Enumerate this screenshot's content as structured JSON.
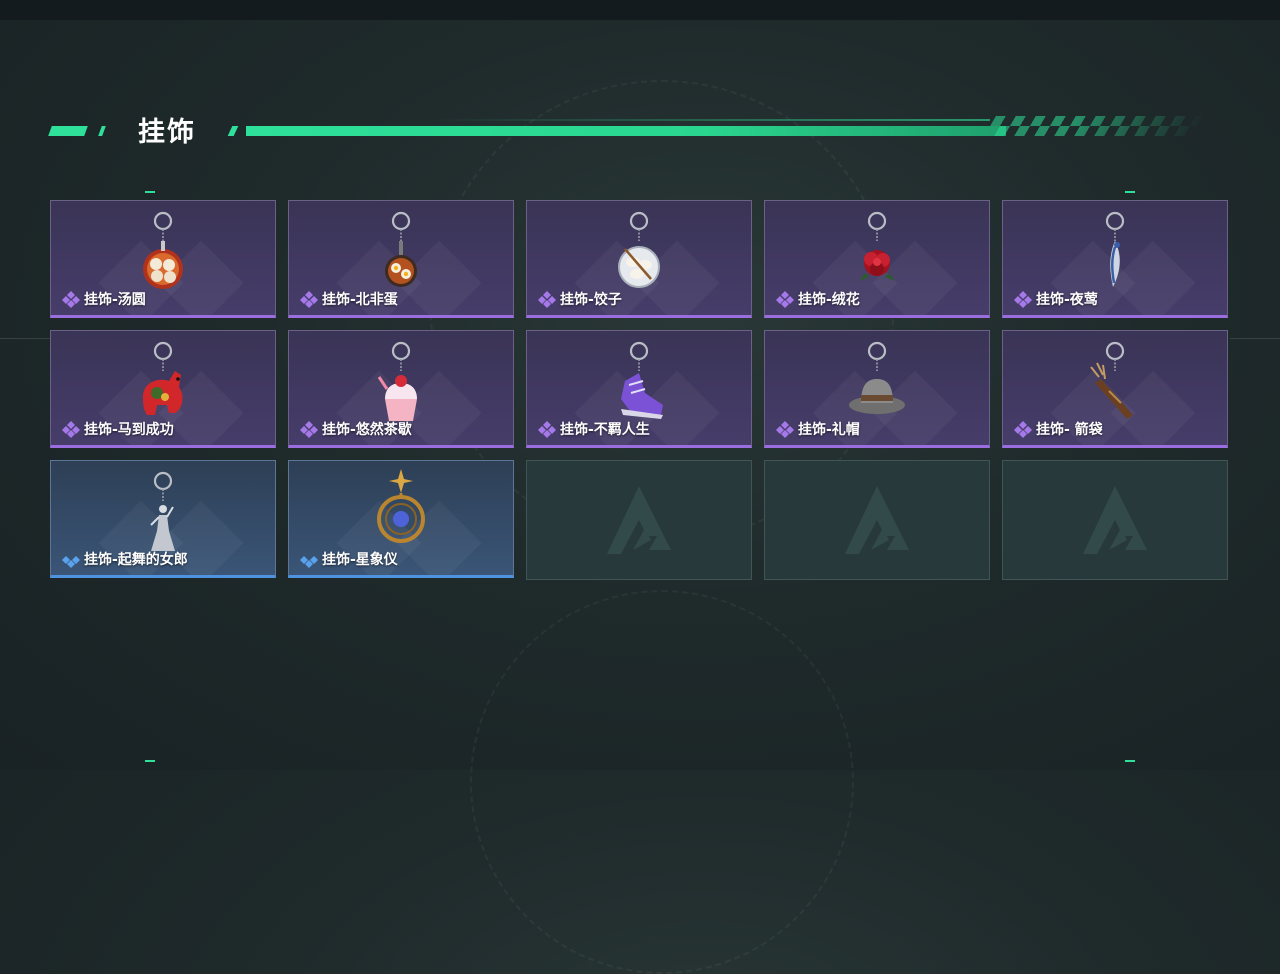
{
  "section": {
    "title": "挂饰"
  },
  "colors": {
    "accent": "#2ee09a",
    "epic": "#9b6ee0",
    "rare": "#4f93e0"
  },
  "items": [
    {
      "name": "挂饰-汤圆",
      "rarity": "epic",
      "icon": "tangyuan-charm-icon"
    },
    {
      "name": "挂饰-北非蛋",
      "rarity": "epic",
      "icon": "shakshuka-charm-icon"
    },
    {
      "name": "挂饰-饺子",
      "rarity": "epic",
      "icon": "dumplings-charm-icon"
    },
    {
      "name": "挂饰-绒花",
      "rarity": "epic",
      "icon": "velvet-flower-charm-icon"
    },
    {
      "name": "挂饰-夜莺",
      "rarity": "epic",
      "icon": "nightingale-charm-icon"
    },
    {
      "name": "挂饰-马到成功",
      "rarity": "epic",
      "icon": "horse-charm-icon"
    },
    {
      "name": "挂饰-悠然茶歇",
      "rarity": "epic",
      "icon": "cupcake-charm-icon"
    },
    {
      "name": "挂饰-不羁人生",
      "rarity": "epic",
      "icon": "sneaker-charm-icon"
    },
    {
      "name": "挂饰-礼帽",
      "rarity": "epic",
      "icon": "fedora-charm-icon"
    },
    {
      "name": "挂饰- 箭袋",
      "rarity": "epic",
      "icon": "quiver-charm-icon"
    },
    {
      "name": "挂饰-起舞的女郎",
      "rarity": "rare",
      "icon": "dancer-charm-icon"
    },
    {
      "name": "挂饰-星象仪",
      "rarity": "rare",
      "icon": "astrolabe-charm-icon"
    },
    {
      "name": "",
      "rarity": "empty",
      "icon": "empty-slot-logo-icon"
    },
    {
      "name": "",
      "rarity": "empty",
      "icon": "empty-slot-logo-icon"
    },
    {
      "name": "",
      "rarity": "empty",
      "icon": "empty-slot-logo-icon"
    }
  ]
}
